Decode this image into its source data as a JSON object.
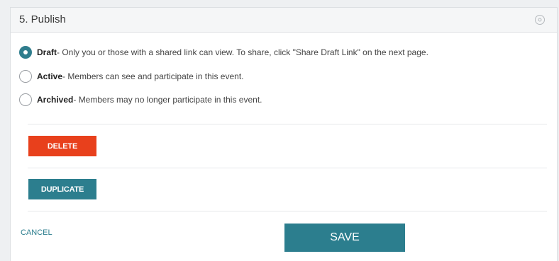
{
  "section": {
    "title": "5. Publish",
    "collapse_icon": "circle-dot-icon"
  },
  "status_options": [
    {
      "name": "Draft",
      "description": " - Only you or those with a shared link can view. To share, click \"Share Draft Link\" on the next page.",
      "selected": true
    },
    {
      "name": "Active",
      "description": " - Members can see and participate in this event.",
      "selected": false
    },
    {
      "name": "Archived",
      "description": " - Members may no longer participate in this event.",
      "selected": false
    }
  ],
  "actions": {
    "delete_label": "DELETE",
    "duplicate_label": "DUPLICATE",
    "cancel_label": "CANCEL",
    "save_label": "SAVE"
  },
  "colors": {
    "accent": "#2c7e8e",
    "danger": "#e8401c"
  }
}
